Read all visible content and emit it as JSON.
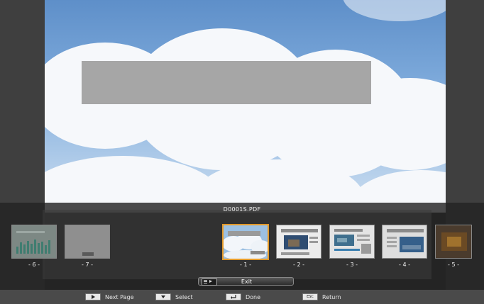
{
  "file_name": "D0001S.PDF",
  "thumbnails": [
    {
      "label": "- 6 -",
      "selected": false
    },
    {
      "label": "- 7 -",
      "selected": false
    },
    {
      "label": "- 1 -",
      "selected": true
    },
    {
      "label": "- 2 -",
      "selected": false
    },
    {
      "label": "- 3 -",
      "selected": false
    },
    {
      "label": "- 4 -",
      "selected": false
    },
    {
      "label": "- 5 -",
      "selected": false
    }
  ],
  "exit_button": {
    "label": "Exit",
    "icon": "menu-key-icon"
  },
  "help": [
    {
      "icon": "play-right-icon",
      "label": "Next Page"
    },
    {
      "icon": "arrow-down-icon",
      "label": "Select"
    },
    {
      "icon": "enter-icon",
      "label": "Done"
    },
    {
      "icon": "esc-key-icon",
      "label": "Return",
      "key_text": "ESC"
    }
  ],
  "colors": {
    "selection_border": "#e39a2a"
  }
}
